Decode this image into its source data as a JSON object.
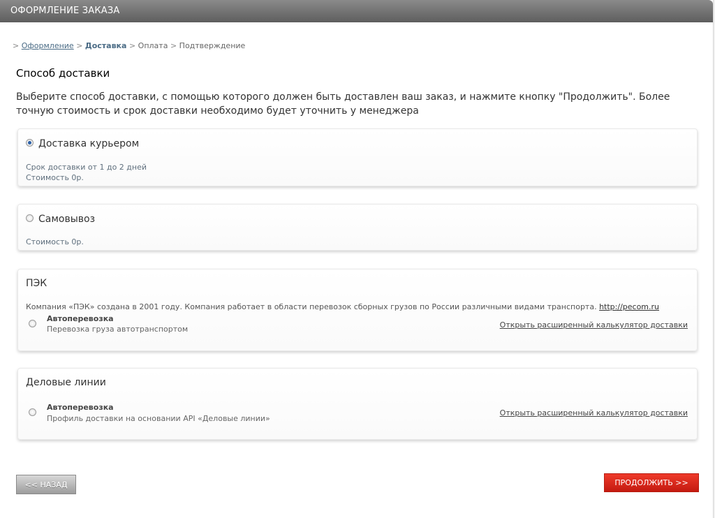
{
  "header": {
    "title": "ОФОРМЛЕНИЕ ЗАКАЗА"
  },
  "breadcrumb": {
    "prefix": ">",
    "sep": ">",
    "steps": [
      "Оформление",
      "Доставка",
      "Оплата",
      "Подтверждение"
    ]
  },
  "page": {
    "title": "Способ доставки",
    "intro": "Выберите способ доставки, с помощью которого должен быть доставлен ваш заказ, и нажмите кнопку \"Продолжить\". Более точную стоимость и срок доставки необходимо будет уточнить у менеджера"
  },
  "delivery": {
    "courier": {
      "label": "Доставка курьером",
      "term": "Срок доставки от 1 до 2 дней",
      "cost": "Стоимость 0р.",
      "selected": true
    },
    "pickup": {
      "label": "Самовывоз",
      "cost": "Стоимость 0р.",
      "selected": false
    },
    "pek": {
      "company": "ПЭК",
      "description": "Компания «ПЭК» создана в 2001 году. Компания работает в области перевозок сборных грузов по России различными видами транспорта.",
      "link": "http://pecom.ru",
      "service_name": "Автоперевозка",
      "service_desc": "Перевозка груза автотранспортом",
      "calc_link": "Открыть расширенный калькулятор доставки"
    },
    "dl": {
      "company": "Деловые линии",
      "service_name": "Автоперевозка",
      "service_desc": "Профиль доставки на основании API «Деловые линии»",
      "calc_link": "Открыть расширенный калькулятор доставки"
    }
  },
  "buttons": {
    "back": "<< НАЗАД",
    "next": "ПРОДОЛЖИТЬ >>"
  },
  "colors": {
    "accent_red": "#d9261a",
    "link_blue": "#4a6b85",
    "radio_selected": "#2a5fa8"
  }
}
